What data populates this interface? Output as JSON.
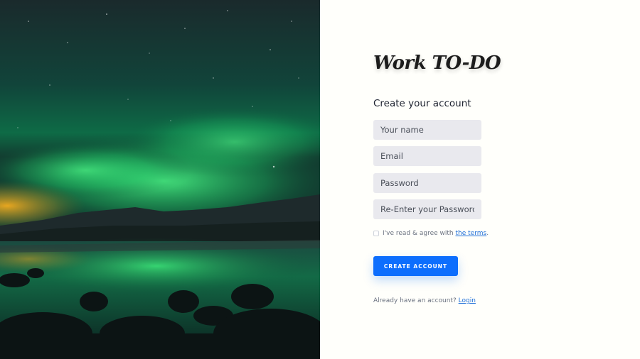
{
  "colors": {
    "accent": "#0d6efd",
    "panel_bg": "#fffffb",
    "field_bg": "#e9e9ee",
    "aurora_green": "#1fd06a"
  },
  "hero": {
    "image": "aurora-borealis-over-lake-photo"
  },
  "brand": {
    "logo_text": "Work TO-DO"
  },
  "form": {
    "title": "Create your account",
    "fields": {
      "name_placeholder": "Your name",
      "email_placeholder": "Email",
      "password_placeholder": "Password",
      "confirm_placeholder": "Re-Enter your Password"
    },
    "terms": {
      "prefix": "I've read & agree with",
      "link": "the terms",
      "suffix": ".",
      "checked": false
    },
    "submit_label": "CREATE ACCOUNT",
    "login_prompt": "Already have an account?",
    "login_link": "Login"
  }
}
